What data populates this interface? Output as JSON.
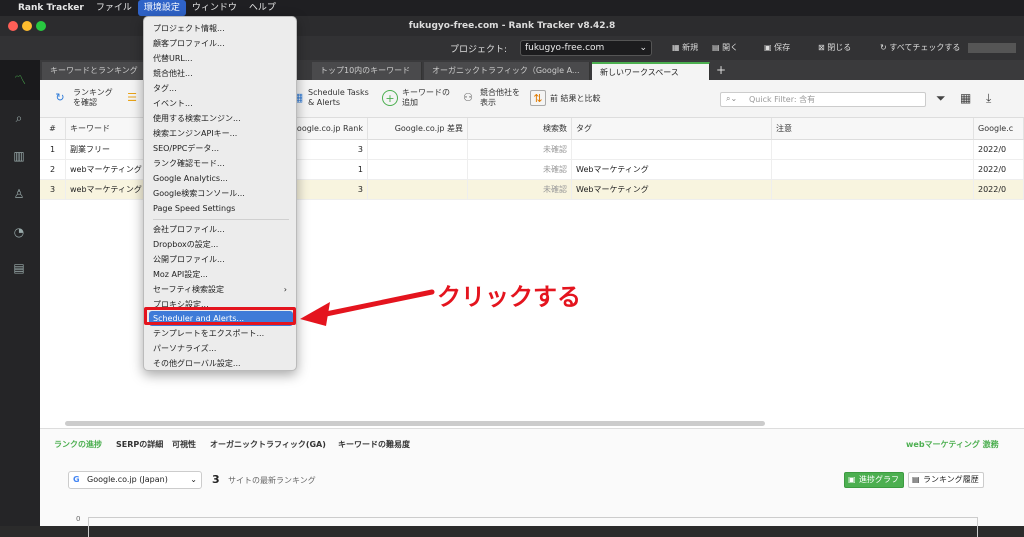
{
  "menubar": {
    "apple": "",
    "app_name": "Rank Tracker",
    "items": [
      "ファイル",
      "環境設定",
      "ウィンドウ",
      "ヘルプ"
    ]
  },
  "window": {
    "title": "fukugyo-free.com - Rank Tracker v8.42.8"
  },
  "project_bar": {
    "label": "プロジェクト:",
    "project": "fukugyo-free.com",
    "actions": [
      "新規",
      "開く",
      "保存",
      "閉じる",
      "すべてチェックする"
    ]
  },
  "tabs": [
    "キーワードとランキング",
    "トップ10内のキーワード",
    "オーガニックトラフィック（Google A...",
    "新しいワークスペース"
  ],
  "toolbar": {
    "check_rankings": "ランキング\nを確認",
    "schedule": "Schedule Tasks\n& Alerts",
    "add_keyword": "キーワードの\n追加",
    "competitors": "競合他社を\n表示",
    "compare": "前 結果と比較",
    "quick_filter_placeholder": "Quick Filter: 含有"
  },
  "table": {
    "headers": [
      "#",
      "キーワード",
      "Google.co.jp Rank",
      "Google.co.jp 差異",
      "検索数",
      "タグ",
      "注意",
      "Google.c"
    ],
    "rows": [
      {
        "n": "1",
        "keyword": "副業フリー",
        "rank": "3",
        "diff": "",
        "volume": "未確認",
        "tag": "",
        "note": "",
        "date": "2022/0"
      },
      {
        "n": "2",
        "keyword": "webマーケティング",
        "rank": "1",
        "diff": "",
        "volume": "未確認",
        "tag": "Webマーケティング",
        "note": "",
        "date": "2022/0"
      },
      {
        "n": "3",
        "keyword": "webマーケティング",
        "rank": "3",
        "diff": "",
        "volume": "未確認",
        "tag": "Webマーケティング",
        "note": "",
        "date": "2022/0"
      }
    ]
  },
  "bottom": {
    "tabs": [
      "ランクの進捗",
      "SERPの詳細",
      "可視性",
      "オーガニックトラフィック(GA)",
      "キーワードの難易度"
    ],
    "keyword_label": "webマーケティング 激務",
    "engine": "Google.co.jp (Japan)",
    "count": "3",
    "count_label": "サイトの最新ランキング",
    "progress_graph": "進捗グラフ",
    "ranking_history": "ランキング履歴",
    "axis_zero": "0"
  },
  "dropdown": {
    "group1": [
      "プロジェクト情報...",
      "顧客プロファイル...",
      "代替URL...",
      "競合他社...",
      "タグ...",
      "イベント...",
      "使用する検索エンジン...",
      "検索エンジンAPIキー...",
      "SEO/PPCデータ...",
      "ランク確認モード...",
      "Google Analytics...",
      "Google検索コンソール...",
      "Page Speed Settings"
    ],
    "group2": [
      "会社プロファイル...",
      "Dropboxの設定...",
      "公開プロファイル...",
      "Moz API設定...",
      "セーフティ検索設定",
      "プロキシ設定...",
      "Scheduler and Alerts...",
      "テンプレートをエクスポート...",
      "パーソナライズ...",
      "その他グローバル設定..."
    ]
  },
  "annotation": "クリックする",
  "colors": {
    "accent": "#4caf50",
    "highlight": "#3f7bd8",
    "annotation": "#e4141e"
  }
}
